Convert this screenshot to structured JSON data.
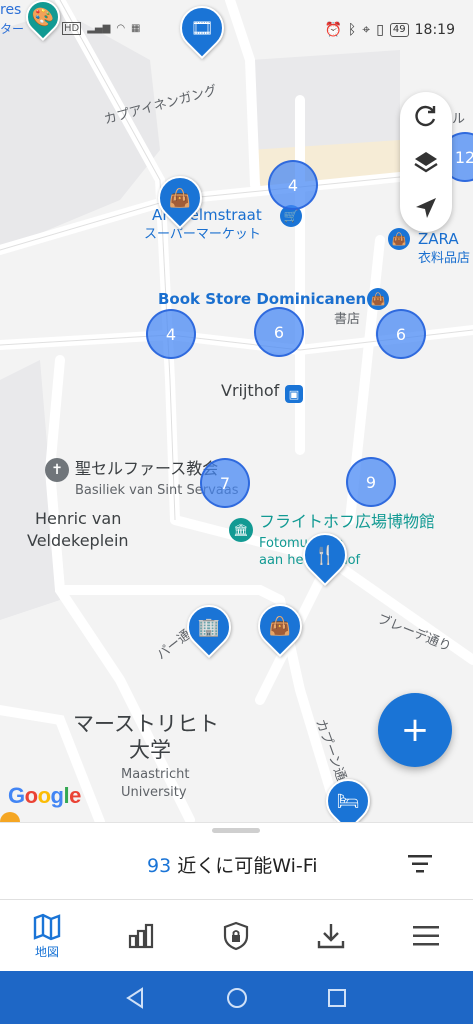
{
  "status_bar": {
    "left_text_top": "res",
    "left_text_bottom": "ター",
    "time": "18:19",
    "battery": "49"
  },
  "map": {
    "clusters": [
      {
        "name": "cluster-4-top",
        "label": "4"
      },
      {
        "name": "cluster-12",
        "label": "12"
      },
      {
        "name": "cluster-4-left",
        "label": "4"
      },
      {
        "name": "cluster-6-center",
        "label": "6"
      },
      {
        "name": "cluster-6-right",
        "label": "6"
      },
      {
        "name": "cluster-7",
        "label": "7"
      },
      {
        "name": "cluster-9",
        "label": "9"
      }
    ],
    "labels": {
      "street_top": "カプアイネンガング",
      "ah": "AH Helmstraat",
      "ah_sub": "スーパーマーケット",
      "zara": "ZARA",
      "zara_sub": "衣料品店",
      "bookstore": "Book Store Dominicanen",
      "bookstore_sub": "書店",
      "vrijthof": "Vrijthof",
      "church_jp": "聖セルファース教会",
      "church_nl": "Basiliek van Sint Servaas",
      "henric_1": "Henric van",
      "henric_2": "Veldekeplein",
      "museum_jp": "フライトホフ広場博物館",
      "museum_nl_1": "Fotomuseum",
      "museum_nl_2": "aan het Vrijthof",
      "street_bredestraat": "ブレーデ通り",
      "street_left": "パー通り",
      "street_capucijnen": "カプーン通",
      "univ_jp_1": "マーストリヒト",
      "univ_jp_2": "大学",
      "univ_nl_1": "Maastricht",
      "univ_nl_2": "University",
      "right_edge_top": "ル"
    },
    "google": [
      "G",
      "o",
      "o",
      "g",
      "l",
      "e"
    ]
  },
  "bottom_sheet": {
    "count": "93",
    "text": " 近くに可能Wi-Fi"
  },
  "tabs": [
    {
      "label": "地図",
      "icon": "map-icon"
    },
    {
      "label": "",
      "icon": "stats-icon"
    },
    {
      "label": "",
      "icon": "vpn-shield-icon"
    },
    {
      "label": "",
      "icon": "download-icon"
    },
    {
      "label": "",
      "icon": "menu-icon"
    }
  ],
  "colors": {
    "accent": "#1a74d6",
    "navbar": "#1e67c6"
  }
}
